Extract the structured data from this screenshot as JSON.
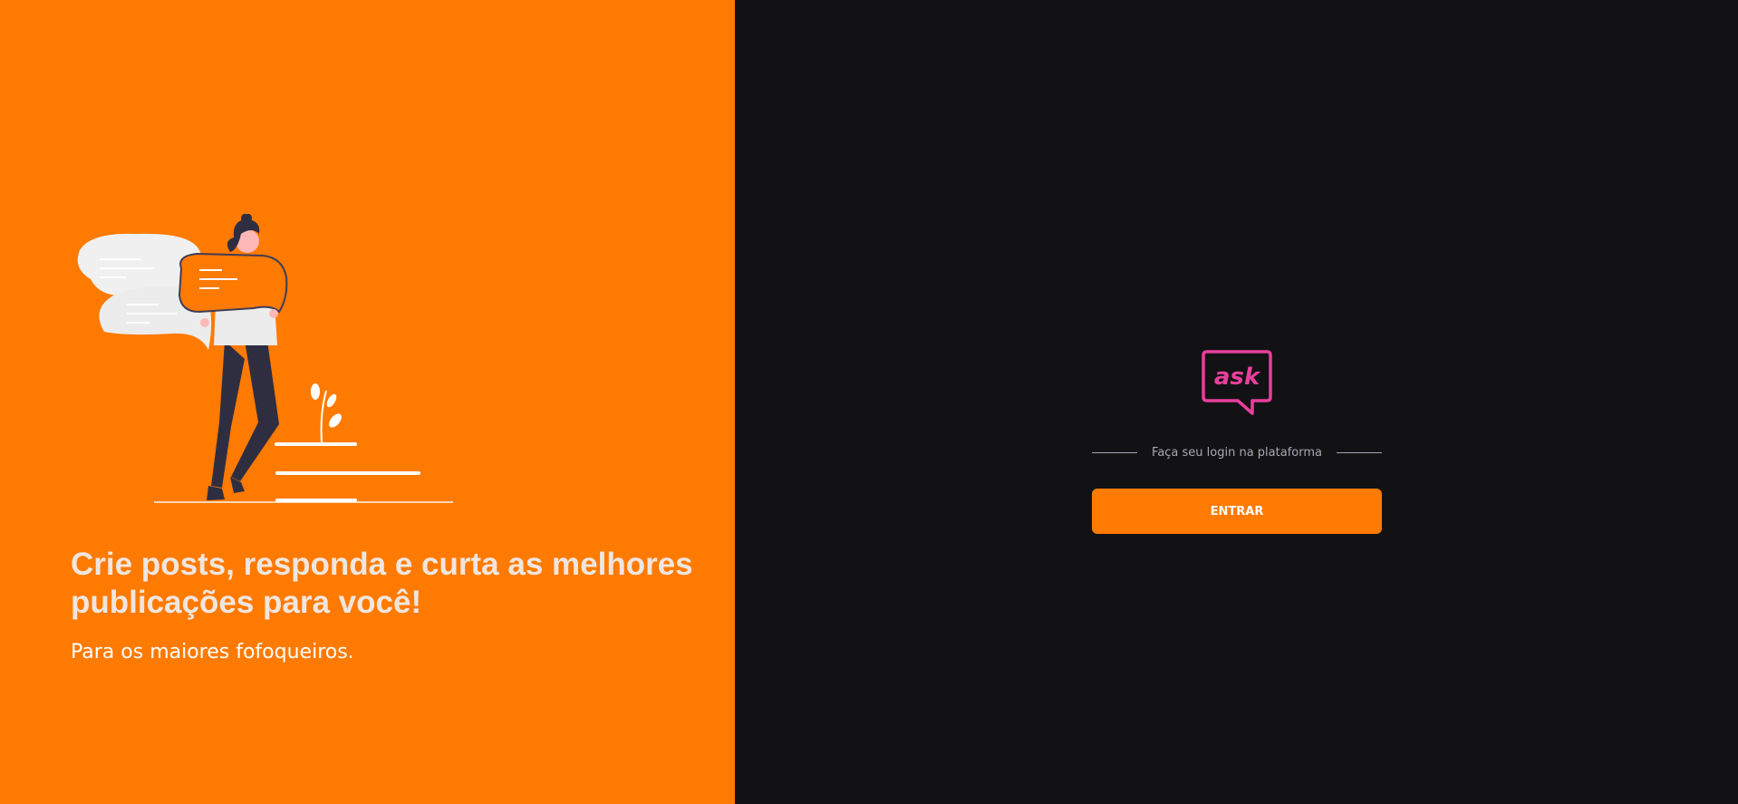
{
  "colors": {
    "left_background": "#ff7a00",
    "right_background": "#121214",
    "accent": "#ff7a00",
    "logo": "#e83f9c",
    "muted_text": "#a8a8b3"
  },
  "hero": {
    "illustration_icon": "woman-with-speech-bubbles-illustration",
    "headline": "Crie posts, responda e curta as melhores publicações para você!",
    "subline": "Para os maiores fofoqueiros."
  },
  "login": {
    "logo_icon": "ask-logo-speech-bubble",
    "logo_text": "ask",
    "separator_text": "Faça seu login na plataforma",
    "enter_label": "ENTRAR"
  }
}
